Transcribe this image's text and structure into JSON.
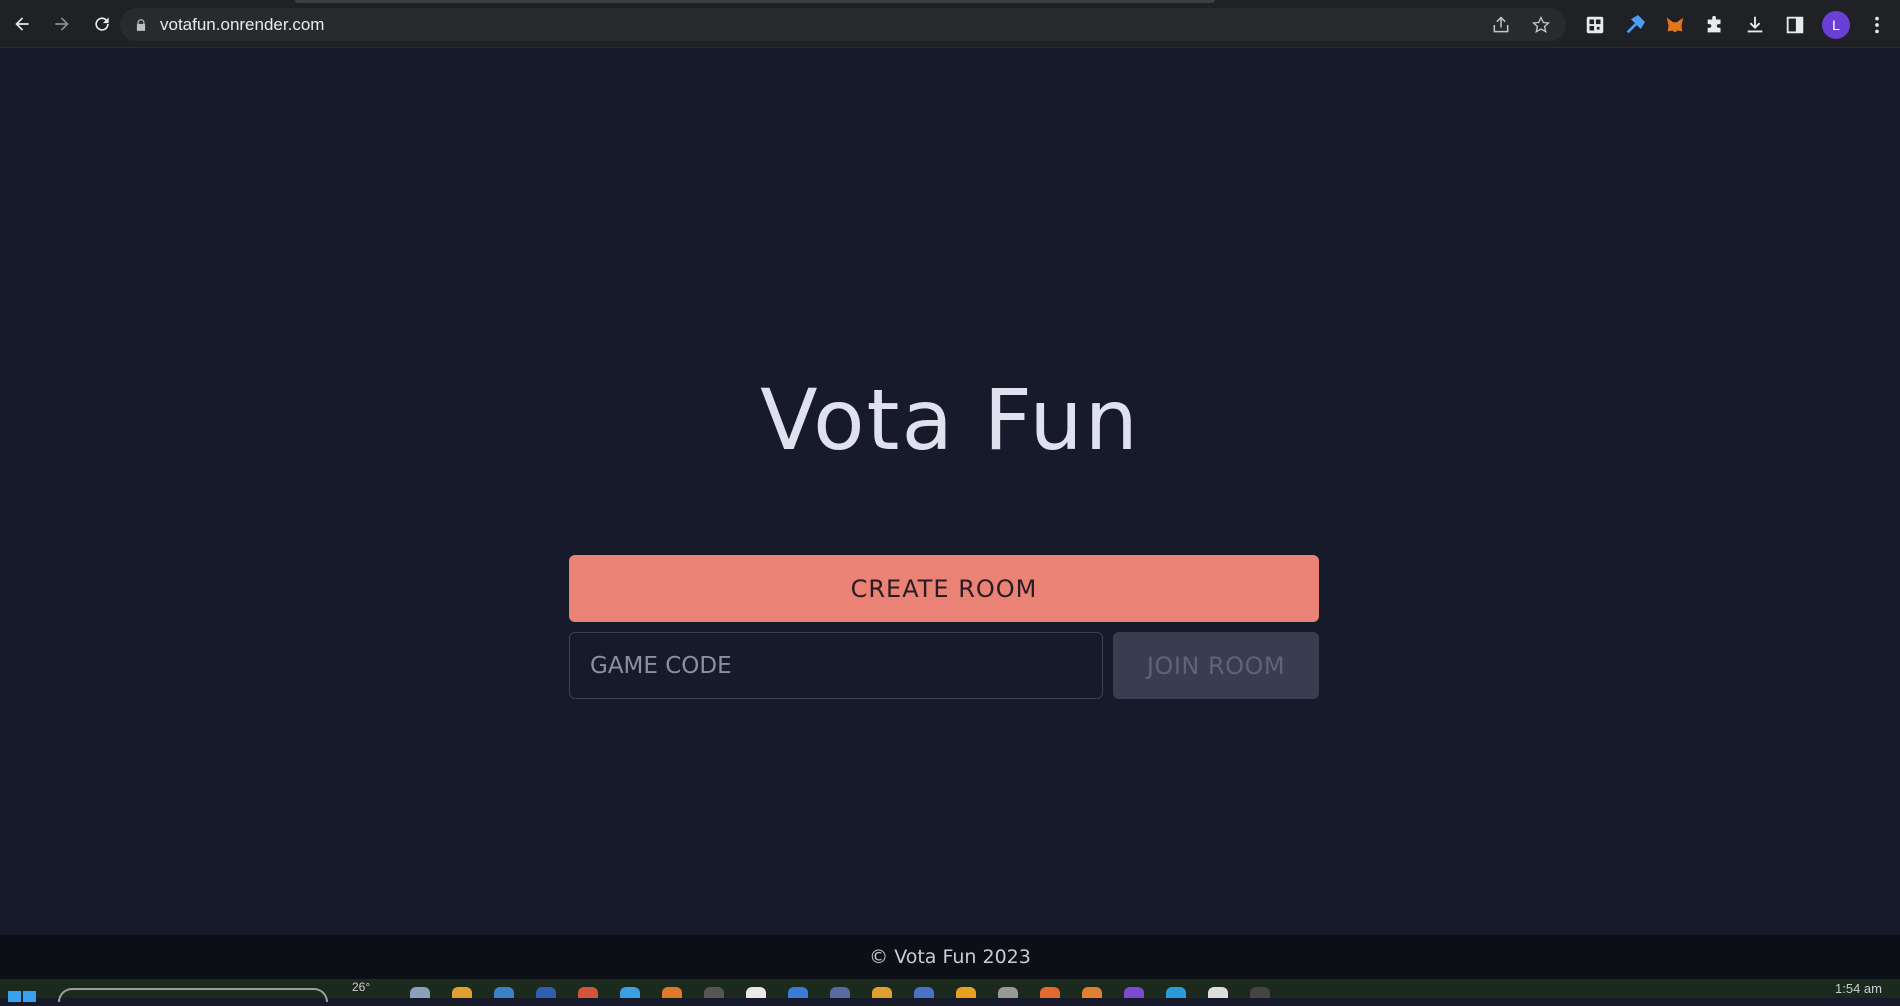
{
  "browser": {
    "url": "votafun.onrender.com",
    "avatar_letter": "L"
  },
  "app": {
    "title": "Vota Fun",
    "create_button": "CREATE ROOM",
    "code_placeholder": "GAME CODE",
    "join_button": "JOIN ROOM",
    "footer": "© Vota Fun 2023"
  },
  "taskbar": {
    "weather": "26°",
    "clock": "1:54 am"
  },
  "colors": {
    "background": "#161a2b",
    "accent": "#ea8376",
    "disabled_button": "#393d4f",
    "footer_bg": "#0d0f17"
  }
}
